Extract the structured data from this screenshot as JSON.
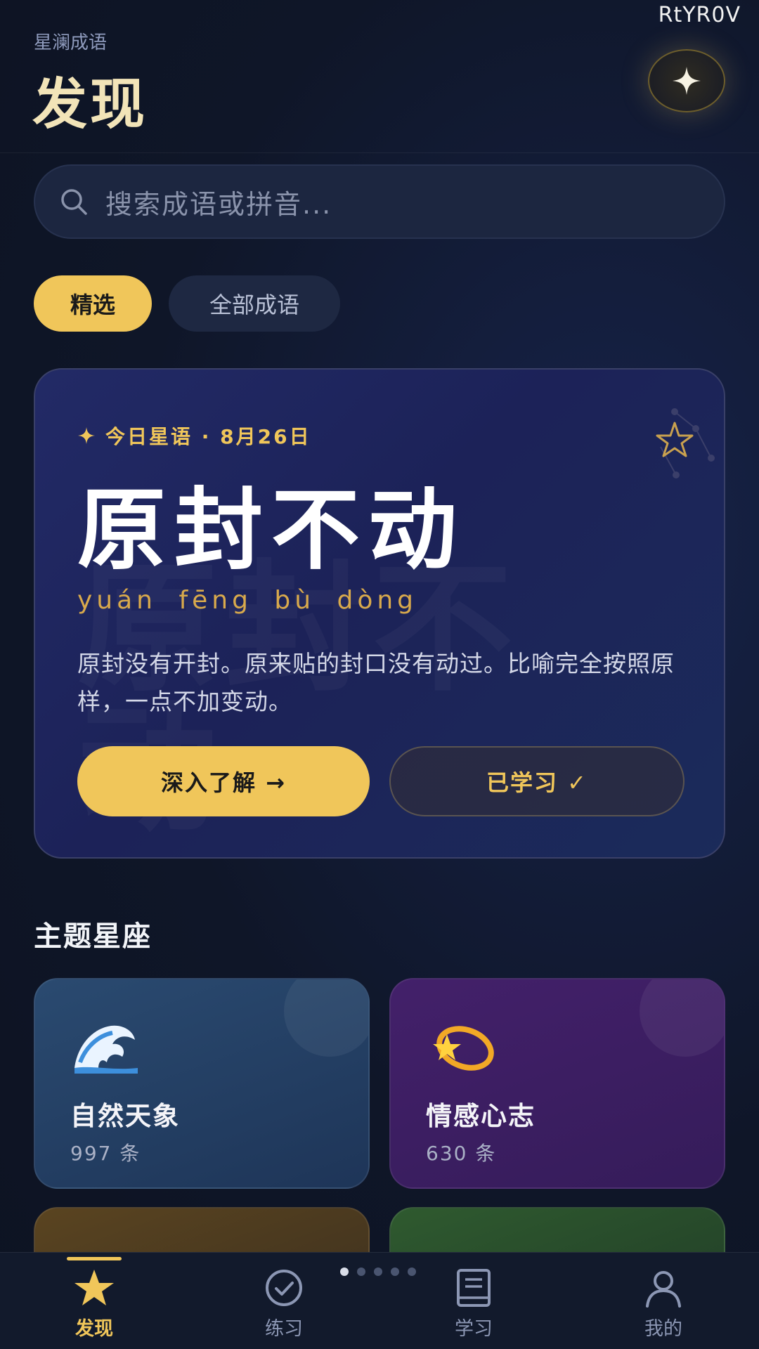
{
  "watermark": "RtYR0V",
  "header": {
    "app_name": "星澜成语",
    "title": "发现"
  },
  "search": {
    "placeholder": "搜索成语或拼音..."
  },
  "chips": [
    {
      "label": "精选",
      "active": true
    },
    {
      "label": "全部成语",
      "active": false
    }
  ],
  "daily": {
    "eyebrow": "今日星语 · 8月26日",
    "idiom": "原封不动",
    "pinyin": "yuán fēng bù dòng",
    "description": "原封没有开封。原来贴的封口没有动过。比喻完全按照原样，一点不加变动。",
    "primary_button": "深入了解 →",
    "secondary_button": "已学习 ✓"
  },
  "themes": {
    "section_title": "主题星座",
    "items": [
      {
        "title": "自然天象",
        "count": "997 条",
        "icon": "wave-icon",
        "color": "#2a4a70"
      },
      {
        "title": "情感心志",
        "count": "630 条",
        "icon": "shooting-star-icon",
        "color": "#43206a"
      }
    ]
  },
  "pager": {
    "total": 5,
    "current": 1
  },
  "tabbar": {
    "items": [
      {
        "label": "发现",
        "icon": "star-icon",
        "active": true
      },
      {
        "label": "练习",
        "icon": "check-circle-icon",
        "active": false
      },
      {
        "label": "学习",
        "icon": "book-icon",
        "active": false
      },
      {
        "label": "我的",
        "icon": "user-icon",
        "active": false
      }
    ]
  },
  "colors": {
    "accent": "#f0c65a",
    "background": "#0f1628"
  }
}
